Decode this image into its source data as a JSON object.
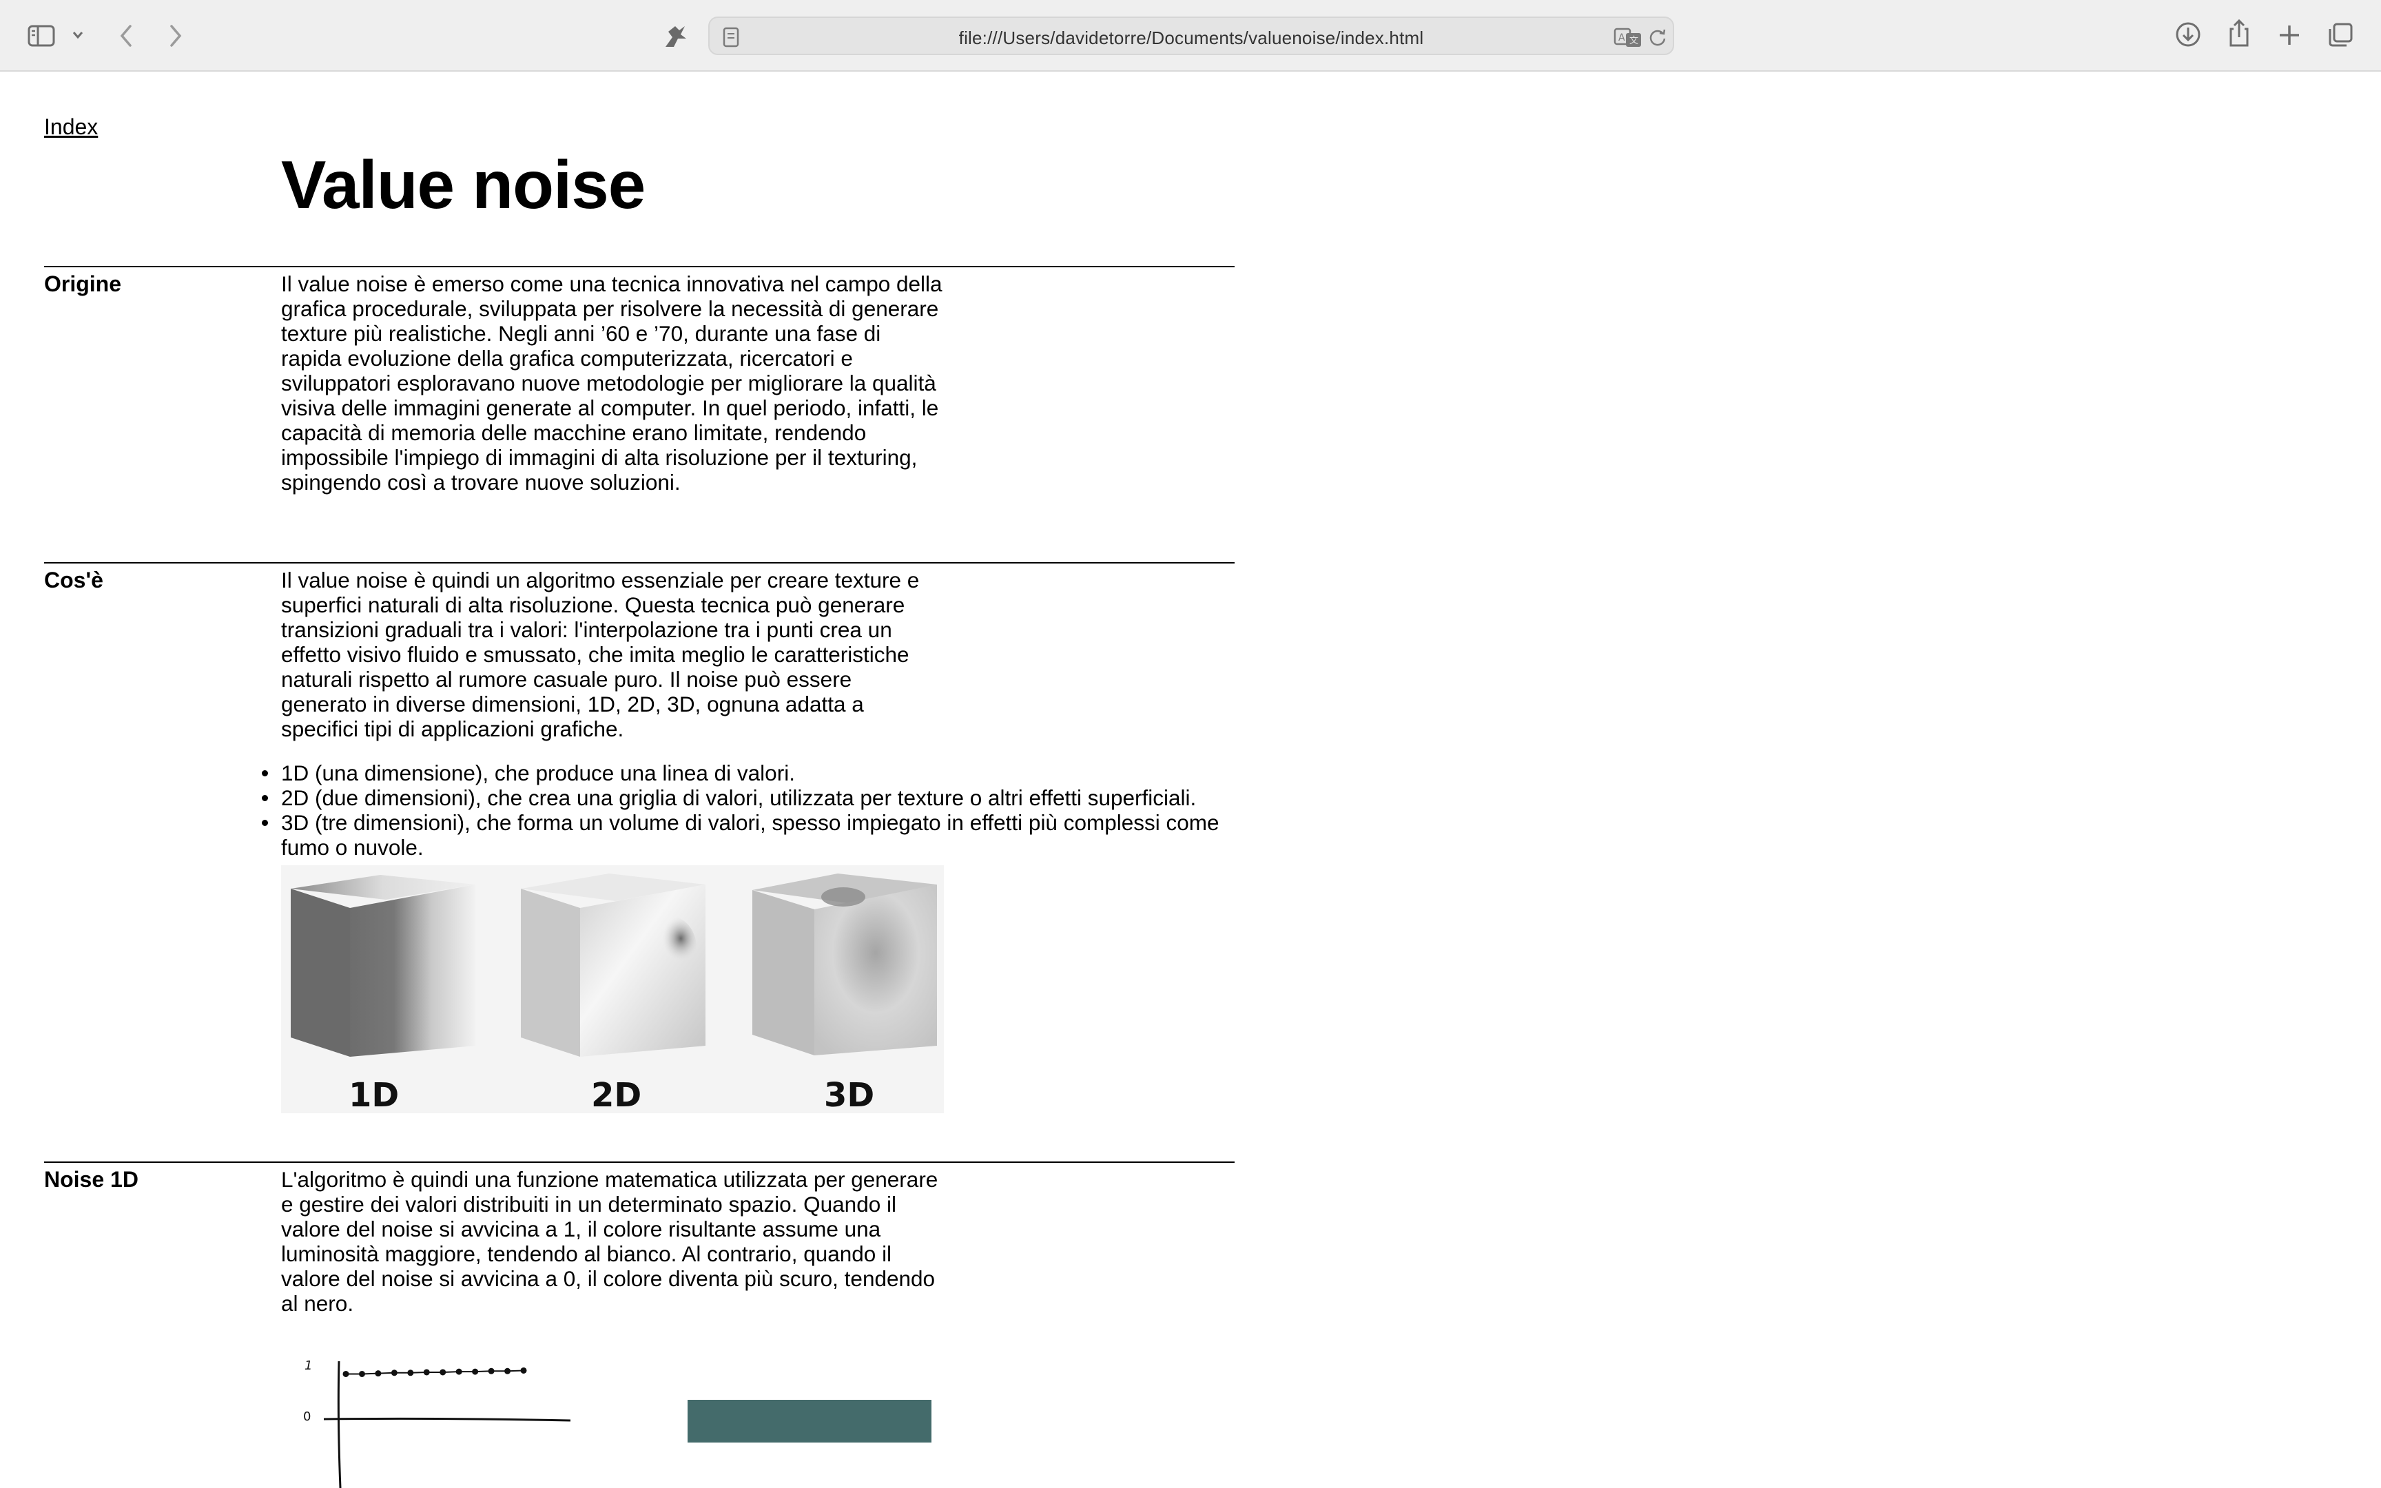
{
  "browser": {
    "url": "file:///Users/davidetorre/Documents/valuenoise/index.html",
    "icons": [
      "sidebar-icon",
      "chevron-down-icon",
      "back-icon",
      "forward-icon",
      "extension-icon",
      "page-icon",
      "translate-icon",
      "reload-icon",
      "download-icon",
      "share-icon",
      "new-tab-icon",
      "tabs-overview-icon"
    ]
  },
  "page": {
    "index_link": "Index",
    "title": "Value noise",
    "sections": [
      {
        "label": "Origine",
        "text": "Il value noise è emerso come una tecnica innovativa nel campo della grafica procedurale, sviluppata per risolvere la necessità di generare texture più realistiche. Negli anni ’60 e ’70, durante una fase di rapida evoluzione della grafica computerizzata, ricercatori e sviluppatori esploravano nuove metodologie per migliorare la qualità visiva delle immagini generate al computer. In quel periodo, infatti, le capacità di memoria delle macchine erano limitate, rendendo impossibile l'impiego di immagini di alta risoluzione per il texturing, spingendo così a trovare nuove soluzioni."
      },
      {
        "label": "Cos'è",
        "text": "Il value noise è quindi un algoritmo essenziale per creare texture e superfici naturali di alta risoluzione. Questa tecnica può generare transizioni graduali tra i valori: l'interpolazione tra i punti crea un effetto visivo fluido e smussato, che imita meglio le caratteristiche naturali rispetto al rumore casuale puro. Il noise può essere generato in diverse dimensioni, 1D, 2D, 3D, ognuna adatta a specifici tipi di applicazioni grafiche.",
        "list": [
          "1D (una dimensione), che produce una linea di valori.",
          "2D (due dimensioni), che crea una griglia di valori, utilizzata per texture o altri effetti superficiali.",
          "3D (tre dimensioni), che forma un volume di valori, spesso impiegato in effetti più complessi come fumo o nuvole."
        ],
        "figure_labels": [
          "1D",
          "2D",
          "3D"
        ]
      },
      {
        "label": "Noise 1D",
        "text": "L'algoritmo è quindi una funzione matematica utilizzata per generare e gestire dei valori distribuiti in un determinato spazio. Quando il valore del noise si avvicina a 1, il colore risultante assume una luminosità maggiore, tendendo al bianco. Al contrario, quando il valore del noise si avvicina a 0, il colore diventa più scuro, tendendo al nero.",
        "chart_ticks": [
          "1",
          "0"
        ],
        "swatch_color": "#446b6b"
      }
    ]
  },
  "chart_data": {
    "type": "line",
    "title": "",
    "xlabel": "",
    "ylabel": "",
    "yticks": [
      "1",
      "0"
    ],
    "ylim": [
      0,
      1
    ],
    "x": [
      1,
      2,
      3,
      4,
      5,
      6,
      7,
      8,
      9,
      10,
      11,
      12
    ],
    "series": [
      {
        "values": [
          0.78,
          0.78,
          0.79,
          0.8,
          0.8,
          0.81,
          0.81,
          0.82,
          0.82,
          0.83,
          0.83,
          0.84
        ]
      }
    ]
  }
}
